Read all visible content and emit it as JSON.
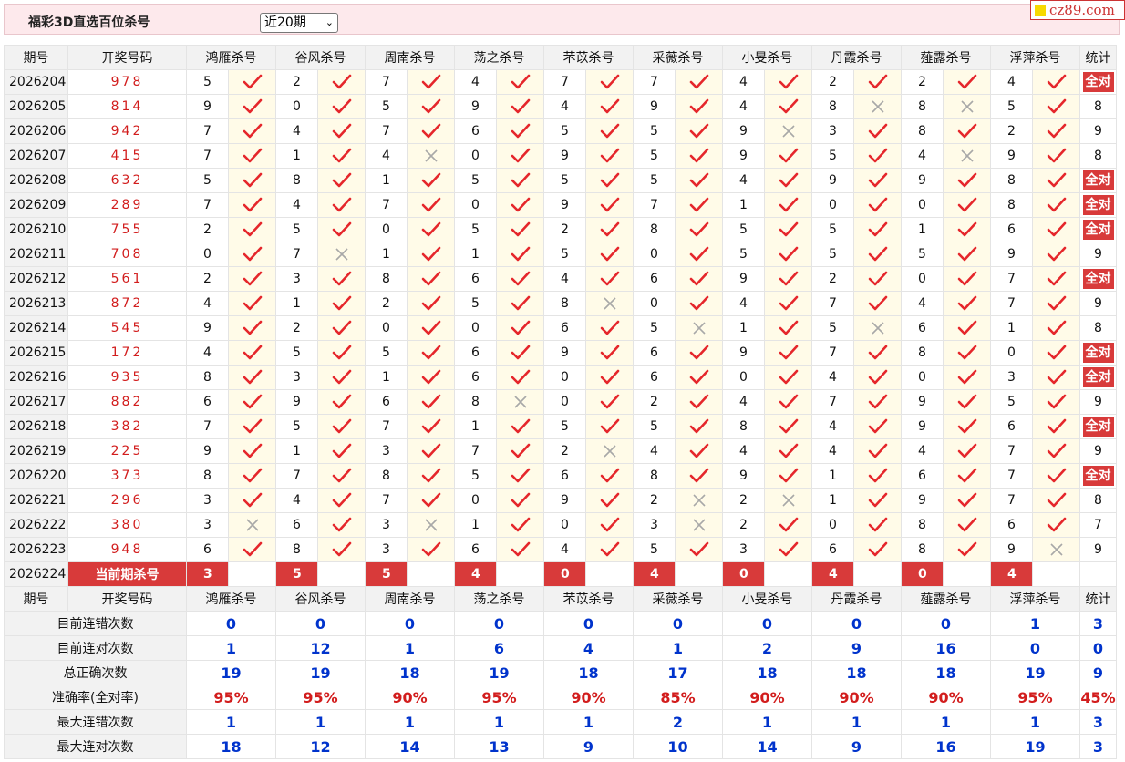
{
  "header": {
    "title": "福彩3D直选百位杀号",
    "select_value": "近20期",
    "logo_text": "cz89.com"
  },
  "columns": {
    "issue": "期号",
    "draw": "开奖号码",
    "stat": "统计",
    "experts": [
      "鸿雁杀号",
      "谷风杀号",
      "周南杀号",
      "荡之杀号",
      "芣苡杀号",
      "采薇杀号",
      "小旻杀号",
      "丹霞杀号",
      "薤露杀号",
      "浮萍杀号"
    ]
  },
  "rows": [
    {
      "issue": "2026204",
      "draw": "978",
      "kills": [
        "5",
        "2",
        "7",
        "4",
        "7",
        "7",
        "4",
        "2",
        "2",
        "4"
      ],
      "ok": [
        1,
        1,
        1,
        1,
        1,
        1,
        1,
        1,
        1,
        1
      ],
      "stat": "全对"
    },
    {
      "issue": "2026205",
      "draw": "814",
      "kills": [
        "9",
        "0",
        "5",
        "9",
        "4",
        "9",
        "4",
        "8",
        "8",
        "5"
      ],
      "ok": [
        1,
        1,
        1,
        1,
        1,
        1,
        1,
        0,
        0,
        1
      ],
      "stat": "8"
    },
    {
      "issue": "2026206",
      "draw": "942",
      "kills": [
        "7",
        "4",
        "7",
        "6",
        "5",
        "5",
        "9",
        "3",
        "8",
        "2"
      ],
      "ok": [
        1,
        1,
        1,
        1,
        1,
        1,
        0,
        1,
        1,
        1
      ],
      "stat": "9"
    },
    {
      "issue": "2026207",
      "draw": "415",
      "kills": [
        "7",
        "1",
        "4",
        "0",
        "9",
        "5",
        "9",
        "5",
        "4",
        "9"
      ],
      "ok": [
        1,
        1,
        0,
        1,
        1,
        1,
        1,
        1,
        0,
        1
      ],
      "stat": "8"
    },
    {
      "issue": "2026208",
      "draw": "632",
      "kills": [
        "5",
        "8",
        "1",
        "5",
        "5",
        "5",
        "4",
        "9",
        "9",
        "8"
      ],
      "ok": [
        1,
        1,
        1,
        1,
        1,
        1,
        1,
        1,
        1,
        1
      ],
      "stat": "全对"
    },
    {
      "issue": "2026209",
      "draw": "289",
      "kills": [
        "7",
        "4",
        "7",
        "0",
        "9",
        "7",
        "1",
        "0",
        "0",
        "8"
      ],
      "ok": [
        1,
        1,
        1,
        1,
        1,
        1,
        1,
        1,
        1,
        1
      ],
      "stat": "全对"
    },
    {
      "issue": "2026210",
      "draw": "755",
      "kills": [
        "2",
        "5",
        "0",
        "5",
        "2",
        "8",
        "5",
        "5",
        "1",
        "6"
      ],
      "ok": [
        1,
        1,
        1,
        1,
        1,
        1,
        1,
        1,
        1,
        1
      ],
      "stat": "全对"
    },
    {
      "issue": "2026211",
      "draw": "708",
      "kills": [
        "0",
        "7",
        "1",
        "1",
        "5",
        "0",
        "5",
        "5",
        "5",
        "9"
      ],
      "ok": [
        1,
        0,
        1,
        1,
        1,
        1,
        1,
        1,
        1,
        1
      ],
      "stat": "9"
    },
    {
      "issue": "2026212",
      "draw": "561",
      "kills": [
        "2",
        "3",
        "8",
        "6",
        "4",
        "6",
        "9",
        "2",
        "0",
        "7"
      ],
      "ok": [
        1,
        1,
        1,
        1,
        1,
        1,
        1,
        1,
        1,
        1
      ],
      "stat": "全对"
    },
    {
      "issue": "2026213",
      "draw": "872",
      "kills": [
        "4",
        "1",
        "2",
        "5",
        "8",
        "0",
        "4",
        "7",
        "4",
        "7"
      ],
      "ok": [
        1,
        1,
        1,
        1,
        0,
        1,
        1,
        1,
        1,
        1
      ],
      "stat": "9"
    },
    {
      "issue": "2026214",
      "draw": "545",
      "kills": [
        "9",
        "2",
        "0",
        "0",
        "6",
        "5",
        "1",
        "5",
        "6",
        "1"
      ],
      "ok": [
        1,
        1,
        1,
        1,
        1,
        0,
        1,
        0,
        1,
        1
      ],
      "stat": "8"
    },
    {
      "issue": "2026215",
      "draw": "172",
      "kills": [
        "4",
        "5",
        "5",
        "6",
        "9",
        "6",
        "9",
        "7",
        "8",
        "0"
      ],
      "ok": [
        1,
        1,
        1,
        1,
        1,
        1,
        1,
        1,
        1,
        1
      ],
      "stat": "全对"
    },
    {
      "issue": "2026216",
      "draw": "935",
      "kills": [
        "8",
        "3",
        "1",
        "6",
        "0",
        "6",
        "0",
        "4",
        "0",
        "3"
      ],
      "ok": [
        1,
        1,
        1,
        1,
        1,
        1,
        1,
        1,
        1,
        1
      ],
      "stat": "全对"
    },
    {
      "issue": "2026217",
      "draw": "882",
      "kills": [
        "6",
        "9",
        "6",
        "8",
        "0",
        "2",
        "4",
        "7",
        "9",
        "5"
      ],
      "ok": [
        1,
        1,
        1,
        0,
        1,
        1,
        1,
        1,
        1,
        1
      ],
      "stat": "9"
    },
    {
      "issue": "2026218",
      "draw": "382",
      "kills": [
        "7",
        "5",
        "7",
        "1",
        "5",
        "5",
        "8",
        "4",
        "9",
        "6"
      ],
      "ok": [
        1,
        1,
        1,
        1,
        1,
        1,
        1,
        1,
        1,
        1
      ],
      "stat": "全对"
    },
    {
      "issue": "2026219",
      "draw": "225",
      "kills": [
        "9",
        "1",
        "3",
        "7",
        "2",
        "4",
        "4",
        "4",
        "4",
        "7"
      ],
      "ok": [
        1,
        1,
        1,
        1,
        0,
        1,
        1,
        1,
        1,
        1
      ],
      "stat": "9"
    },
    {
      "issue": "2026220",
      "draw": "373",
      "kills": [
        "8",
        "7",
        "8",
        "5",
        "6",
        "8",
        "9",
        "1",
        "6",
        "7"
      ],
      "ok": [
        1,
        1,
        1,
        1,
        1,
        1,
        1,
        1,
        1,
        1
      ],
      "stat": "全对"
    },
    {
      "issue": "2026221",
      "draw": "296",
      "kills": [
        "3",
        "4",
        "7",
        "0",
        "9",
        "2",
        "2",
        "1",
        "9",
        "7"
      ],
      "ok": [
        1,
        1,
        1,
        1,
        1,
        0,
        0,
        1,
        1,
        1
      ],
      "stat": "8"
    },
    {
      "issue": "2026222",
      "draw": "380",
      "kills": [
        "3",
        "6",
        "3",
        "1",
        "0",
        "3",
        "2",
        "0",
        "8",
        "6"
      ],
      "ok": [
        0,
        1,
        0,
        1,
        1,
        0,
        1,
        1,
        1,
        1
      ],
      "stat": "7"
    },
    {
      "issue": "2026223",
      "draw": "948",
      "kills": [
        "6",
        "8",
        "3",
        "6",
        "4",
        "5",
        "3",
        "6",
        "8",
        "9"
      ],
      "ok": [
        1,
        1,
        1,
        1,
        1,
        1,
        1,
        1,
        1,
        0
      ],
      "stat": "9"
    }
  ],
  "current": {
    "issue": "2026224",
    "label": "当前期杀号",
    "kills": [
      "3",
      "5",
      "5",
      "4",
      "0",
      "4",
      "0",
      "4",
      "0",
      "4"
    ]
  },
  "stats": [
    {
      "label": "目前连错次数",
      "values": [
        "0",
        "0",
        "0",
        "0",
        "0",
        "0",
        "0",
        "0",
        "0",
        "1"
      ],
      "stat": "3",
      "color": "blue"
    },
    {
      "label": "目前连对次数",
      "values": [
        "1",
        "12",
        "1",
        "6",
        "4",
        "1",
        "2",
        "9",
        "16",
        "0"
      ],
      "stat": "0",
      "color": "blue"
    },
    {
      "label": "总正确次数",
      "values": [
        "19",
        "19",
        "18",
        "19",
        "18",
        "17",
        "18",
        "18",
        "18",
        "19"
      ],
      "stat": "9",
      "color": "blue"
    },
    {
      "label": "准确率(全对率)",
      "values": [
        "95%",
        "95%",
        "90%",
        "95%",
        "90%",
        "85%",
        "90%",
        "90%",
        "90%",
        "95%"
      ],
      "stat": "45%",
      "color": "red"
    },
    {
      "label": "最大连错次数",
      "values": [
        "1",
        "1",
        "1",
        "1",
        "1",
        "2",
        "1",
        "1",
        "1",
        "1"
      ],
      "stat": "3",
      "color": "blue"
    },
    {
      "label": "最大连对次数",
      "values": [
        "18",
        "12",
        "14",
        "13",
        "9",
        "10",
        "14",
        "9",
        "16",
        "19"
      ],
      "stat": "3",
      "color": "blue"
    }
  ]
}
